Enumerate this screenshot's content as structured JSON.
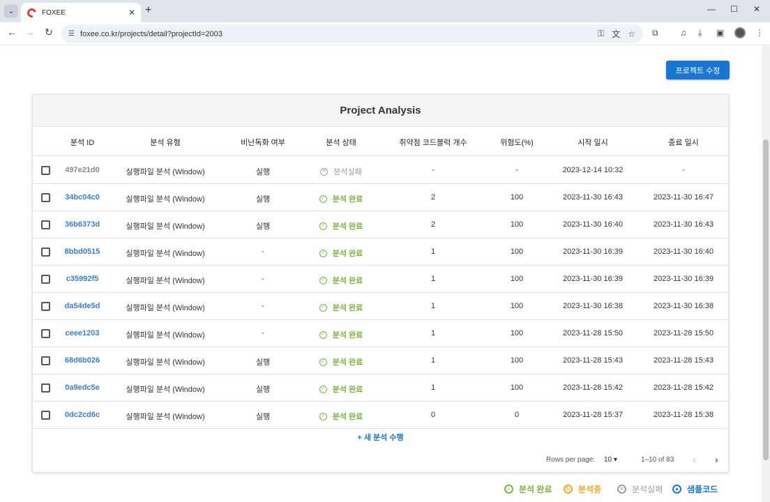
{
  "browser": {
    "tab_title": "FOXEE",
    "url": "foxee.co.kr/projects/detail?projectId=2003"
  },
  "page": {
    "edit_button": "프로젝트 수정",
    "card_title": "Project Analysis",
    "columns": [
      "분석 ID",
      "분석 유형",
      "비난독화 여부",
      "분석 상태",
      "취약점 코드블럭 개수",
      "위험도(%)",
      "시작 일시",
      "종료 일시"
    ],
    "rows": [
      {
        "id": "497e21d0",
        "type": "실행파일 분석 (Window)",
        "deobf": "실행",
        "status": "분석실패",
        "status_kind": "fail",
        "vuln": "-",
        "risk": "-",
        "start": "2023-12-14 10:32",
        "end": "-"
      },
      {
        "id": "34bc04c0",
        "type": "실행파일 분석 (Window)",
        "deobf": "실행",
        "status": "분석 완료",
        "status_kind": "done",
        "vuln": "2",
        "risk": "100",
        "start": "2023-11-30 16:43",
        "end": "2023-11-30 16:47"
      },
      {
        "id": "36b6373d",
        "type": "실행파일 분석 (Window)",
        "deobf": "실행",
        "status": "분석 완료",
        "status_kind": "done",
        "vuln": "2",
        "risk": "100",
        "start": "2023-11-30 16:40",
        "end": "2023-11-30 16:43"
      },
      {
        "id": "8bbd0515",
        "type": "실행파일 분석 (Window)",
        "deobf": "-",
        "status": "분석 완료",
        "status_kind": "done",
        "vuln": "1",
        "risk": "100",
        "start": "2023-11-30 16:39",
        "end": "2023-11-30 16:40"
      },
      {
        "id": "c35992f5",
        "type": "실행파일 분석 (Window)",
        "deobf": "-",
        "status": "분석 완료",
        "status_kind": "done",
        "vuln": "1",
        "risk": "100",
        "start": "2023-11-30 16:39",
        "end": "2023-11-30 16:39"
      },
      {
        "id": "da54de5d",
        "type": "실행파일 분석 (Window)",
        "deobf": "-",
        "status": "분석 완료",
        "status_kind": "done",
        "vuln": "1",
        "risk": "100",
        "start": "2023-11-30 16:38",
        "end": "2023-11-30 16:38"
      },
      {
        "id": "ceee1203",
        "type": "실행파일 분석 (Window)",
        "deobf": "-",
        "status": "분석 완료",
        "status_kind": "done",
        "vuln": "1",
        "risk": "100",
        "start": "2023-11-28 15:50",
        "end": "2023-11-28 15:50"
      },
      {
        "id": "68d6b026",
        "type": "실행파일 분석 (Window)",
        "deobf": "실행",
        "status": "분석 완료",
        "status_kind": "done",
        "vuln": "1",
        "risk": "100",
        "start": "2023-11-28 15:43",
        "end": "2023-11-28 15:43"
      },
      {
        "id": "0a9edc5e",
        "type": "실행파일 분석 (Window)",
        "deobf": "실행",
        "status": "분석 완료",
        "status_kind": "done",
        "vuln": "1",
        "risk": "100",
        "start": "2023-11-28 15:42",
        "end": "2023-11-28 15:42"
      },
      {
        "id": "0dc2cd6c",
        "type": "실행파일 분석 (Window)",
        "deobf": "실행",
        "status": "분석 완료",
        "status_kind": "done",
        "vuln": "0",
        "risk": "0",
        "start": "2023-11-28 15:37",
        "end": "2023-11-28 15:38"
      }
    ],
    "new_analysis": "+ 새 분석 수행",
    "rows_per_page_label": "Rows per page:",
    "rows_per_page_value": "10",
    "page_range": "1–10 of 83",
    "legend": [
      {
        "label": "분석 완료",
        "color": "#7cb342",
        "icon": "check-circle-icon"
      },
      {
        "label": "분석중",
        "color": "#f5a623",
        "icon": "spinner-icon"
      },
      {
        "label": "분석실패",
        "color": "#9e9e9e",
        "icon": "x-circle-icon"
      },
      {
        "label": "샘플코드",
        "color": "#1976d2",
        "icon": "radio-circle-icon"
      }
    ]
  }
}
